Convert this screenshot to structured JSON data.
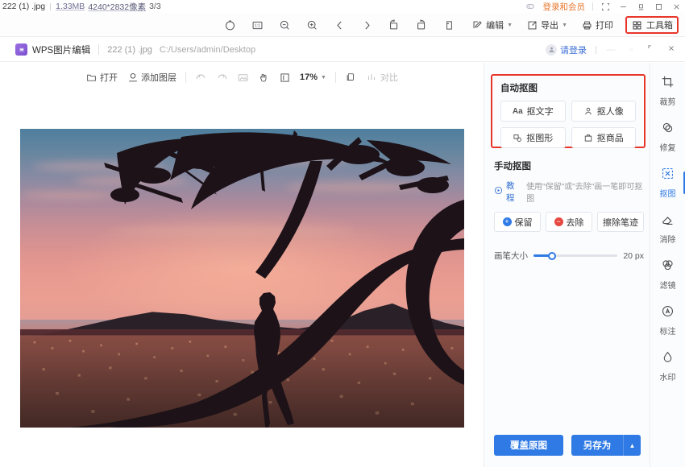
{
  "hostbar": {
    "filename": "222 (1) .jpg",
    "filesize": "1.33MB",
    "dimensions": "4240*2832像素",
    "page_counter": "3/3",
    "login_label": "登录和会员",
    "icons": [
      "pin-icon",
      "fit-window-icon",
      "minimize-icon",
      "restore-icon",
      "maximize-icon",
      "close-icon"
    ]
  },
  "toolbar": {
    "center_icons": [
      {
        "name": "rotate-icon",
        "label": "旋转"
      },
      {
        "name": "actual-size-icon",
        "label": "1:1"
      },
      {
        "name": "zoom-out-icon",
        "label": "缩小"
      },
      {
        "name": "zoom-in-icon",
        "label": "放大"
      },
      {
        "name": "prev-image-icon",
        "label": "上一张"
      },
      {
        "name": "next-image-icon",
        "label": "下一张"
      },
      {
        "name": "rotate-left-icon",
        "label": "左旋转"
      },
      {
        "name": "rotate-right-icon",
        "label": "右旋转"
      },
      {
        "name": "delete-icon",
        "label": "删除"
      }
    ],
    "edit_label": "编辑",
    "export_label": "导出",
    "print_label": "打印",
    "toolbox_label": "工具箱",
    "toolbox_highlight_color": "#e8352a"
  },
  "docbar": {
    "app_title": "WPS图片编辑",
    "file_name": "222 (1) .jpg",
    "file_path": "C:/Users/admin/Desktop",
    "login_label": "请登录",
    "restore_icon": "restore-icon",
    "close_icon": "close-icon"
  },
  "editor_toolbar": {
    "open_label": "打开",
    "add_layer_label": "添加图层",
    "undo_icon": "undo-icon",
    "redo_icon": "redo-icon",
    "image_icon": "image-icon",
    "hand_icon": "hand-icon",
    "fit_icon": "fit-screen-icon",
    "zoom_value": "17%",
    "copy_icon": "copy-icon",
    "compare_label": "对比"
  },
  "panel": {
    "auto_section": {
      "title": "自动抠图",
      "buttons": [
        {
          "label": "抠文字",
          "icon": "text-cutout-icon",
          "glyph": "Aa"
        },
        {
          "label": "抠人像",
          "icon": "portrait-cutout-icon",
          "glyph": "person"
        },
        {
          "label": "抠图形",
          "icon": "shape-cutout-icon",
          "glyph": "shape"
        },
        {
          "label": "抠商品",
          "icon": "product-cutout-icon",
          "glyph": "bag"
        }
      ],
      "highlight_color": "#e8352a"
    },
    "manual_section": {
      "title": "手动抠图",
      "tutorial_label": "教程",
      "hint": "使用\"保留\"或\"去除\"画一笔即可抠图",
      "buttons": [
        {
          "label": "保留",
          "icon": "plus-circle-icon",
          "color": "#2f7ae5"
        },
        {
          "label": "去除",
          "icon": "minus-circle-icon",
          "color": "#e5483f"
        },
        {
          "label": "擦除笔迹",
          "icon": "eraser-icon",
          "color": "#333333"
        }
      ],
      "slider": {
        "label": "画笔大小",
        "value": "20 px",
        "percent": 22,
        "accent": "#2f7ae5"
      }
    },
    "footer": {
      "overwrite_label": "覆盖原图",
      "saveas_label": "另存为",
      "dropdown_icon": "chevron-up-icon",
      "accent": "#2f7ae5"
    }
  },
  "rail": {
    "items": [
      {
        "label": "裁剪",
        "icon": "crop-icon",
        "active": false
      },
      {
        "label": "修复",
        "icon": "repair-icon",
        "active": false
      },
      {
        "label": "抠图",
        "icon": "cutout-icon",
        "active": true
      },
      {
        "label": "消除",
        "icon": "erase-icon",
        "active": false
      },
      {
        "label": "滤镜",
        "icon": "filter-icon",
        "active": false
      },
      {
        "label": "标注",
        "icon": "annotate-icon",
        "active": false
      },
      {
        "label": "水印",
        "icon": "watermark-icon",
        "active": false
      }
    ],
    "accent": "#2f7ae5"
  },
  "canvas": {
    "image_alt": "sunset-silhouette-tree-photo"
  }
}
